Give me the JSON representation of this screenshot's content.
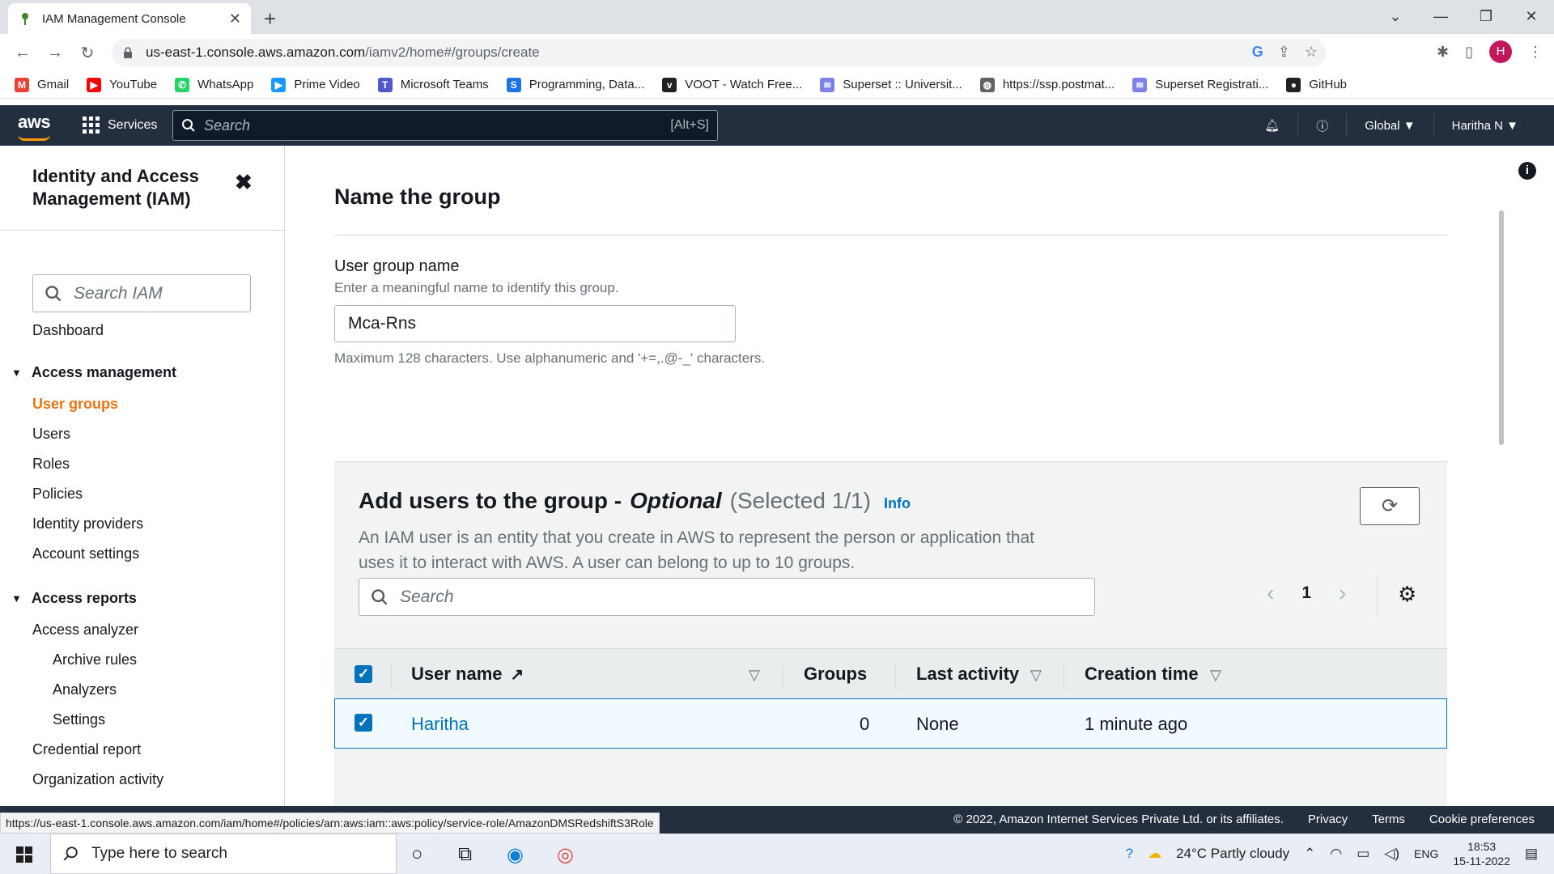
{
  "browser": {
    "tab_title": "IAM Management Console",
    "url_host": "us-east-1.console.aws.amazon.com",
    "url_path": "/iamv2/home#/groups/create",
    "profile_initial": "H",
    "bookmarks": [
      {
        "label": "Gmail",
        "color": "#ea4335",
        "glyph": "M"
      },
      {
        "label": "YouTube",
        "color": "#ff0000",
        "glyph": "▶"
      },
      {
        "label": "WhatsApp",
        "color": "#25d366",
        "glyph": "✆"
      },
      {
        "label": "Prime Video",
        "color": "#1a98ff",
        "glyph": "▶"
      },
      {
        "label": "Microsoft Teams",
        "color": "#5059c9",
        "glyph": "T"
      },
      {
        "label": "Programming, Data...",
        "color": "#1a73e8",
        "glyph": "S"
      },
      {
        "label": "VOOT - Watch Free...",
        "color": "#202124",
        "glyph": "v"
      },
      {
        "label": "Superset :: Universit...",
        "color": "#7b83eb",
        "glyph": "≋"
      },
      {
        "label": "https://ssp.postmat...",
        "color": "#5f6368",
        "glyph": "◍"
      },
      {
        "label": "Superset Registrati...",
        "color": "#7b83eb",
        "glyph": "≋"
      },
      {
        "label": "GitHub",
        "color": "#202124",
        "glyph": "●"
      }
    ]
  },
  "awsnav": {
    "logo": "aws",
    "services": "Services",
    "search_placeholder": "Search",
    "search_shortcut": "[Alt+S]",
    "region": "Global ▼",
    "user": "Haritha N ▼"
  },
  "sidebar": {
    "title": "Identity and Access Management (IAM)",
    "search_placeholder": "Search IAM",
    "dashboard": "Dashboard",
    "access_management": "Access management",
    "user_groups": "User groups",
    "users": "Users",
    "roles": "Roles",
    "policies": "Policies",
    "identity_providers": "Identity providers",
    "account_settings": "Account settings",
    "access_reports": "Access reports",
    "access_analyzer": "Access analyzer",
    "archive_rules": "Archive rules",
    "analyzers": "Analyzers",
    "settings": "Settings",
    "credential_report": "Credential report",
    "organization_activity": "Organization activity"
  },
  "form": {
    "section_title": "Name the group",
    "label": "User group name",
    "description": "Enter a meaningful name to identify this group.",
    "value": "Mca-Rns",
    "constraint": "Maximum 128 characters. Use alphanumeric and '+=,.@-_' characters."
  },
  "users_panel": {
    "title": "Add users to the group -",
    "optional": "Optional",
    "selected": "(Selected 1/1)",
    "info": "Info",
    "description": "An IAM user is an entity that you create in AWS to represent the person or application that uses it to interact with AWS. A user can belong to up to 10 groups.",
    "search_placeholder": "Search",
    "page": "1",
    "columns": {
      "user_name": "User name",
      "groups": "Groups",
      "last_activity": "Last activity",
      "creation_time": "Creation time"
    },
    "rows": [
      {
        "user_name": "Haritha",
        "groups": "0",
        "last_activity": "None",
        "creation_time": "1 minute ago"
      }
    ]
  },
  "footer": {
    "status_url": "https://us-east-1.console.aws.amazon.com/iam/home#/policies/arn:aws:iam::aws:policy/service-role/AmazonDMSRedshiftS3Role",
    "copyright": "© 2022, Amazon Internet Services Private Ltd. or its affiliates.",
    "privacy": "Privacy",
    "terms": "Terms",
    "cookie": "Cookie preferences"
  },
  "taskbar": {
    "search_placeholder": "Type here to search",
    "weather": "24°C  Partly cloudy",
    "lang": "ENG",
    "time": "18:53",
    "date": "15-11-2022"
  }
}
